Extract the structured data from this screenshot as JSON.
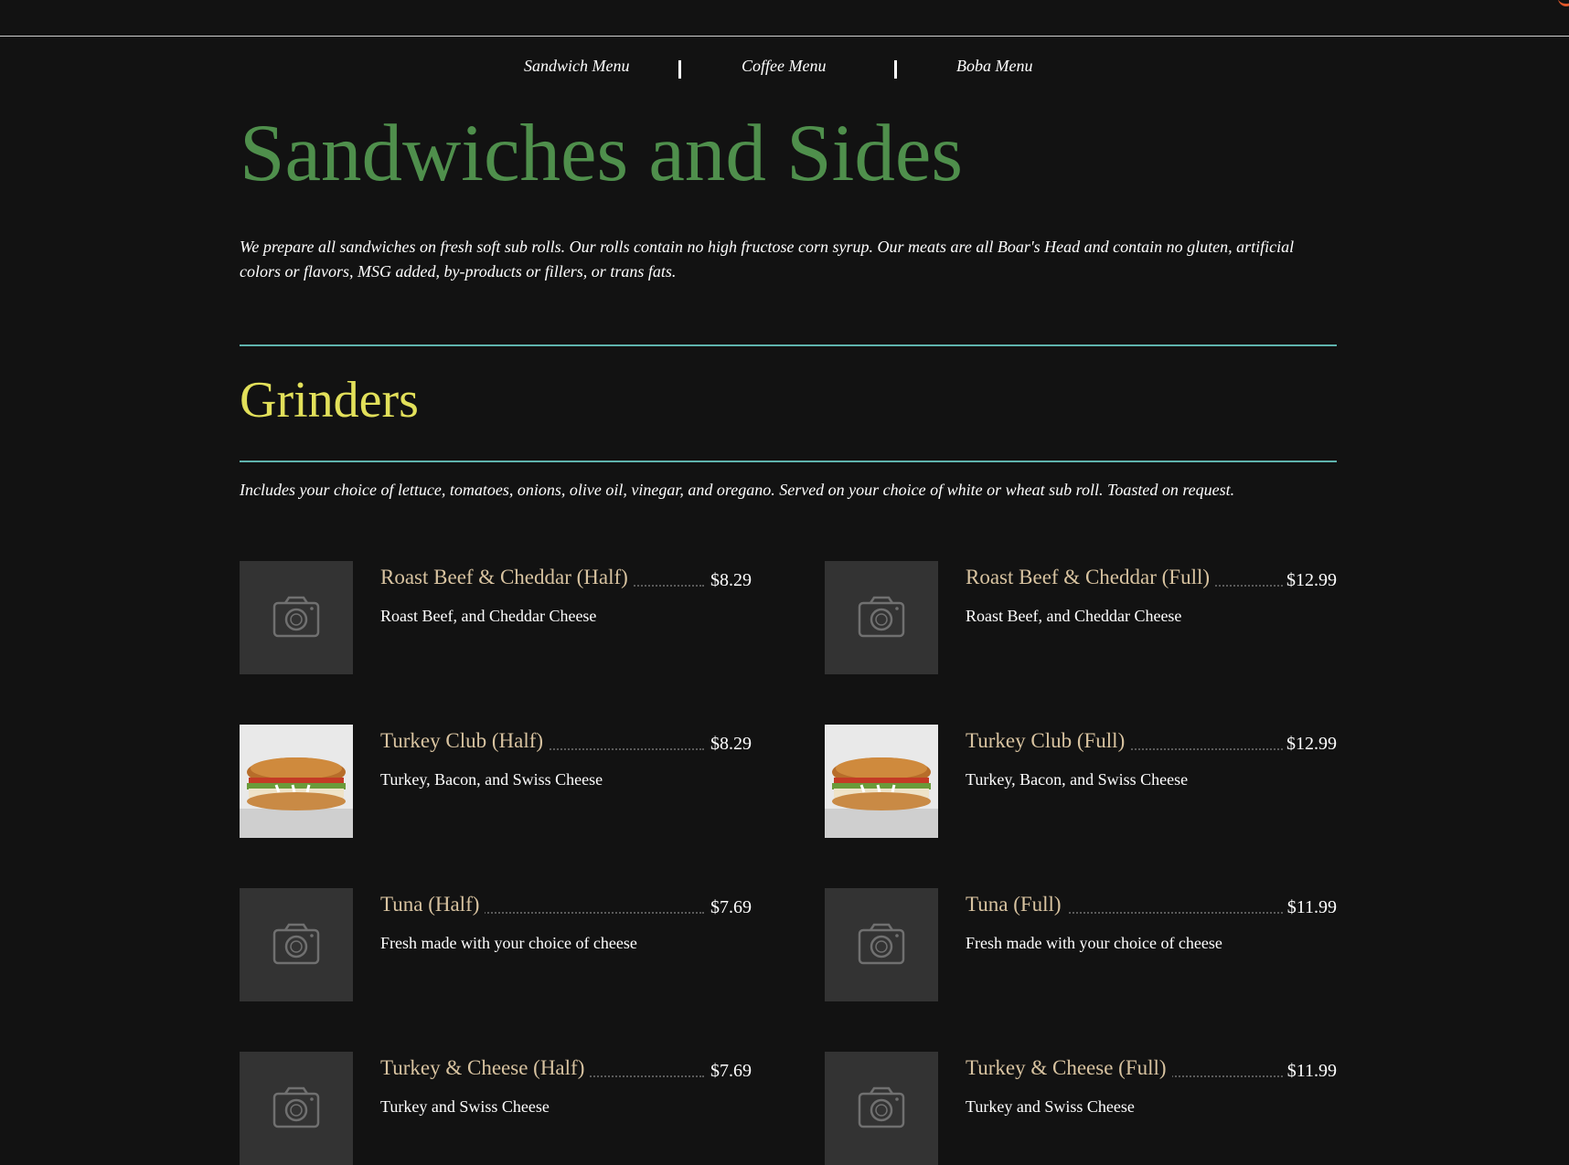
{
  "nav": {
    "items": [
      {
        "label": "Sandwich Menu"
      },
      {
        "label": "Coffee Menu"
      },
      {
        "label": "Boba Menu"
      }
    ]
  },
  "page": {
    "title": "Sandwiches and Sides",
    "intro": "We prepare all sandwiches on fresh soft sub rolls. Our rolls contain no high fructose corn syrup. Our meats are all Boar's Head and contain no gluten, artificial colors or flavors, MSG added, by-products or fillers, or trans fats."
  },
  "section": {
    "title": "Grinders",
    "description": "Includes your choice of lettuce, tomatoes, onions, olive oil, vinegar, and oregano. Served on your choice of white or wheat sub roll. Toasted on request."
  },
  "items": [
    {
      "name": "Roast Beef & Cheddar (Half)",
      "price": "$8.29",
      "description": "Roast Beef, and Cheddar Cheese",
      "image": "camera-placeholder-icon"
    },
    {
      "name": "Roast Beef & Cheddar (Full)",
      "price": "$12.99",
      "description": "Roast Beef, and Cheddar Cheese",
      "image": "camera-placeholder-icon"
    },
    {
      "name": "Turkey Club (Half)",
      "price": "$8.29",
      "description": "Turkey, Bacon, and Swiss Cheese",
      "image": "sandwich-photo"
    },
    {
      "name": "Turkey Club (Full)",
      "price": "$12.99",
      "description": "Turkey, Bacon, and Swiss Cheese",
      "image": "sandwich-photo"
    },
    {
      "name": "Tuna (Half)",
      "price": "$7.69",
      "description": "Fresh made with your choice of cheese",
      "image": "camera-placeholder-icon"
    },
    {
      "name": "Tuna (Full)",
      "price": "$11.99",
      "description": "Fresh made with your choice of cheese",
      "image": "camera-placeholder-icon"
    },
    {
      "name": "Turkey & Cheese (Half)",
      "price": "$7.69",
      "description": "Turkey and Swiss Cheese",
      "image": "camera-placeholder-icon"
    },
    {
      "name": "Turkey & Cheese (Full)",
      "price": "$11.99",
      "description": "Turkey and Swiss Cheese",
      "image": "camera-placeholder-icon"
    }
  ],
  "colors": {
    "background": "#121212",
    "title_green": "#4f8f4c",
    "section_yellow": "#e2e05a",
    "rule_teal": "#5fb3ae",
    "item_name": "#d8c3a0",
    "placeholder": "#333333"
  }
}
